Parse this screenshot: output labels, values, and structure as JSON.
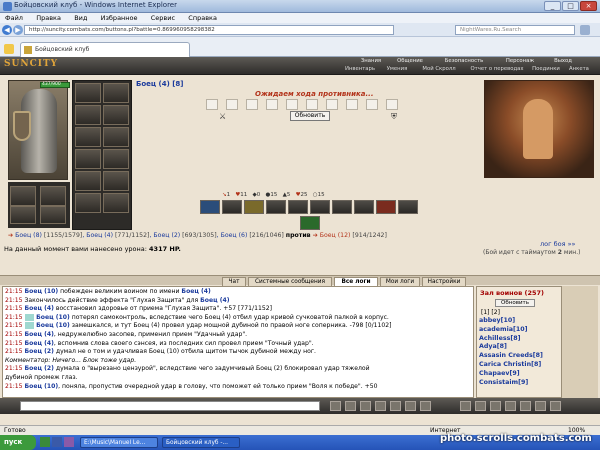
{
  "window": {
    "title": "Бойцовский клуб - Windows Internet Explorer"
  },
  "menubar": {
    "items": [
      "Файл",
      "Правка",
      "Вид",
      "Избранное",
      "Сервис",
      "Справка"
    ]
  },
  "address": {
    "url": "http://suncity.combats.com/buttons.pl?battle=0.869960958298382",
    "search_placeholder": "NightWares.Ru.Search"
  },
  "tab": {
    "label": "Бойцовский клуб"
  },
  "game_nav": {
    "logo": "SUNCITY",
    "row1": [
      "Знания",
      "Общение",
      "Безопасность",
      "Персонаж",
      "Выход"
    ],
    "row2": [
      "Инвентарь",
      "Умения",
      "Мой Скролл",
      "Отчет о переводах",
      "Поединки",
      "Анкета"
    ]
  },
  "fighter": {
    "name": "Боец (4) [8]",
    "hp": "437/900"
  },
  "waiting": {
    "message": "Ожидаем хода противника...",
    "refresh_label": "Обновить"
  },
  "stats_row": [
    "1",
    "11",
    "0",
    "15",
    "5",
    "25",
    "15"
  ],
  "fight_line": {
    "team1": [
      {
        "name": "Боец (8)",
        "hp": "[1155/1579]"
      },
      {
        "name": "Боец (4)",
        "hp": "[771/1152]"
      },
      {
        "name": "Боец (2)",
        "hp": "[693/1305]"
      },
      {
        "name": "Боец (6)",
        "hp": "[216/1046]"
      }
    ],
    "versus": "против",
    "team2": [
      {
        "name": "Боец (12)",
        "hp": "[914/1242]"
      }
    ]
  },
  "damage": {
    "text": "На данный момент вами нанесено урона:",
    "value": "4317 HP."
  },
  "log_link": "лог боя »»",
  "timeout": {
    "text": "(Бой идет с таймаутом",
    "value": "2",
    "unit": "мин.)"
  },
  "chat_tabs": [
    "Чат",
    "Системные сообщения",
    "Все логи",
    "Мои логи",
    "Настройки"
  ],
  "chat_lines": [
    {
      "time": "21:15",
      "name": "Боец (10)",
      "text": "побежден великим воином по имени",
      "tail": "Боец (4)"
    },
    {
      "time": "21:15",
      "name": "",
      "text": "Закончилось действие эффекта \"Глухая Защита\" для",
      "tail": "Боец (4)"
    },
    {
      "time": "21:15",
      "name": "Боец (4)",
      "text": "восстановил здоровье от приема \"Глухая Защита\". +57 [771/1152]",
      "tail": ""
    },
    {
      "time": "21:15",
      "name": "Боец (10)",
      "text": "потерял самоконтроль, вследствие чего Боец (4) отбил удар кривой сучковатой палкой в корпус.",
      "tail": ""
    },
    {
      "time": "21:15",
      "name": "Боец (10)",
      "text": "замешкался, и тут Боец (4) провел удар мощной дубиной по правой ноге соперника. -798 [0/1102]",
      "tail": ""
    },
    {
      "time": "21:15",
      "name": "Боец (4)",
      "text": ", недружелюбно засопев, применил прием \"Удачный удар\".",
      "tail": ""
    },
    {
      "time": "21:15",
      "name": "Боец (4)",
      "text": ", вспомнив слова своего сэнсея, из последних сил провел прием \"Точный удар\".",
      "tail": ""
    },
    {
      "time": "21:15",
      "name": "Боец (2)",
      "text": "думал не о том и удачливая Боец (10) отбила щитом тычок дубиной между ног.",
      "tail": ""
    },
    {
      "time": "",
      "name": "",
      "text": "Комментатор: Ничего... Блок тоже удар.",
      "tail": ""
    },
    {
      "time": "21:15",
      "name": "Боец (2)",
      "text": "думала о \"вырезано цензурой\", вследствие чего задумчивый Боец (2) блокировал удар тяжелой",
      "tail": ""
    },
    {
      "time": "",
      "name": "",
      "text": "дубиной промеж глаз.",
      "tail": ""
    },
    {
      "time": "21:15",
      "name": "Боец (10)",
      "text": ", поняла, пропустив очередной удар в голову, что поможет ей только прием \"Воля к победе\". +50",
      "tail": ""
    }
  ],
  "roster": {
    "title": "Зал воинов (257)",
    "refresh_label": "Обновить",
    "pages": "[1] [2]",
    "players": [
      "abbey[10]",
      "academia[10]",
      "Achilless[8]",
      "Adya[8]",
      "Assasin Creeds[8]",
      "Carica Christin[8]",
      "Chapaev[9]",
      "Consistaim[9]"
    ]
  },
  "statusbar": {
    "left": "Готово",
    "zone": "Интернет",
    "zoom": "100%"
  },
  "taskbar": {
    "start": "пуск",
    "items": [
      "E:\\Music\\Manuel Le...",
      "Бойцовский клуб -..."
    ]
  },
  "watermark": "photo.scrolls.combats.com",
  "colors": {
    "accent": "#b3341b",
    "link": "#1a3a9c",
    "page_bg": "#ece3d3"
  }
}
